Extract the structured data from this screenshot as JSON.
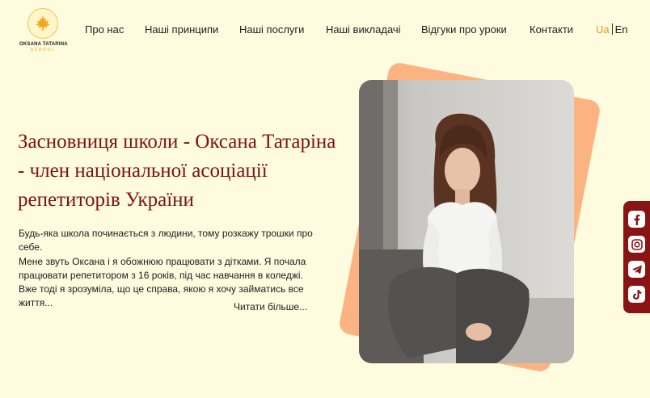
{
  "logo": {
    "name": "OKSANA TATARINA",
    "sub": "SCHOOL"
  },
  "nav": [
    "Про нас",
    "Наші принципи",
    "Наші послуги",
    "Наші викладачі",
    "Відгуки про уроки",
    "Контакти"
  ],
  "lang": {
    "ua": "Ua",
    "en": "En",
    "active_color": "#e59a1e"
  },
  "hero": {
    "title": "Засновниця школи - Оксана Татаріна - член національної асоціації репетиторів України",
    "intro_lines": [
      "Будь-яка школа починається з людини, тому розкажу трошки про себе.",
      "Мене звуть Оксана і я обожнюю працювати з дітками. Я почала працювати репетитором з 16 років, під час навчання в коледжі. Вже тоді я зрозуміла, що це справа, якою я хочу займатись все життя..."
    ],
    "read_more": "Читати більше..."
  },
  "social": [
    "facebook-icon",
    "instagram-icon",
    "telegram-icon",
    "tiktok-icon"
  ],
  "colors": {
    "background": "#fefbdf",
    "title": "#7e1111",
    "accent_card": "#fbb481",
    "social_bar": "#8a1313"
  }
}
